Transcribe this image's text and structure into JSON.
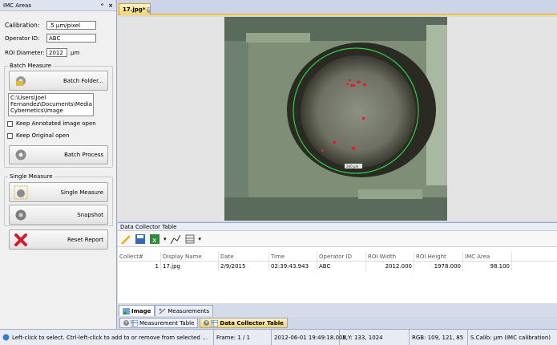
{
  "panel": {
    "title": "IMC Areas",
    "pin": "ᵒ",
    "close": "×"
  },
  "calibration": {
    "label": "Calibration:",
    "value": ".5 µm/pixel"
  },
  "operator": {
    "label": "Operator ID:",
    "value": "ABC"
  },
  "roi": {
    "label": "ROI Diameter:",
    "value": "2012",
    "unit": "µm"
  },
  "batch": {
    "group_label": "Batch Measure",
    "folder_button": "Batch Folder...",
    "path": "C:\\Users\\Joel\nFernandez\\Documents\\Media\nCybernetics\\Image",
    "keep_annotated": "Keep Annotated image open",
    "keep_original": "Keep Original open",
    "process_button": "Batch Process"
  },
  "single": {
    "group_label": "Single Measure",
    "measure_button": "Single Measure",
    "snapshot_button": "Snapshot"
  },
  "reset_button": "Reset Report",
  "doc_tab": {
    "label": "17.jpg*"
  },
  "image_label": "200 µm",
  "dct": {
    "title": "Data Collector Table",
    "columns": [
      "Collect#",
      "Display Name",
      "Date",
      "Time",
      "Operator ID",
      "ROI Width",
      "ROI Height",
      "IMC Area"
    ],
    "rows": [
      [
        "1",
        "17.jpg",
        "2/9/2015",
        "02:39:43.943",
        "ABC",
        "2012.000",
        "1978.000",
        "98.100"
      ]
    ]
  },
  "bottom_tabs": [
    "Image",
    "Measurements"
  ],
  "panel_tabs": [
    "Measurement Table",
    "Data Collector Table"
  ],
  "status": {
    "hint": "Left-click to select.  Ctrl-left-click to add to or remove from selected object...",
    "frame": "Frame: 1 / 1",
    "datetime": "2012-06-01 19:49:18.000",
    "xy": "X,Y: 133, 1024",
    "rgb": "RGB:  109,  121,   85",
    "calib": "S.Calib: µm (IMC calibration)"
  },
  "colors": {
    "accent": "#f6d365",
    "tab_border": "#f2c12e",
    "red_blob": "#e0202a",
    "circle": "#2bd14a"
  }
}
